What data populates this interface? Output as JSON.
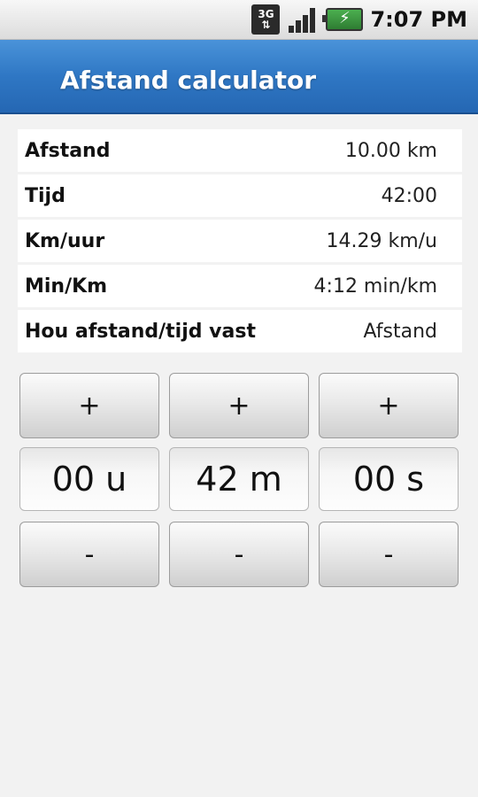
{
  "status_bar": {
    "network": "3G",
    "time": "7:07 PM"
  },
  "app": {
    "title": "Afstand calculator"
  },
  "rows": [
    {
      "label": "Afstand",
      "value": "10.00 km"
    },
    {
      "label": "Tijd",
      "value": "42:00"
    },
    {
      "label": "Km/uur",
      "value": "14.29 km/u"
    },
    {
      "label": "Min/Km",
      "value": "4:12 min/km"
    },
    {
      "label": "Hou afstand/tijd vast",
      "value": "Afstand"
    }
  ],
  "time_picker": {
    "hours": {
      "plus": "+",
      "value": "00 u",
      "minus": "-"
    },
    "minutes": {
      "plus": "+",
      "value": "42 m",
      "minus": "-"
    },
    "seconds": {
      "plus": "+",
      "value": "00 s",
      "minus": "-"
    }
  },
  "colors": {
    "titlebar": "#2f77c4",
    "battery": "#4caf50"
  }
}
